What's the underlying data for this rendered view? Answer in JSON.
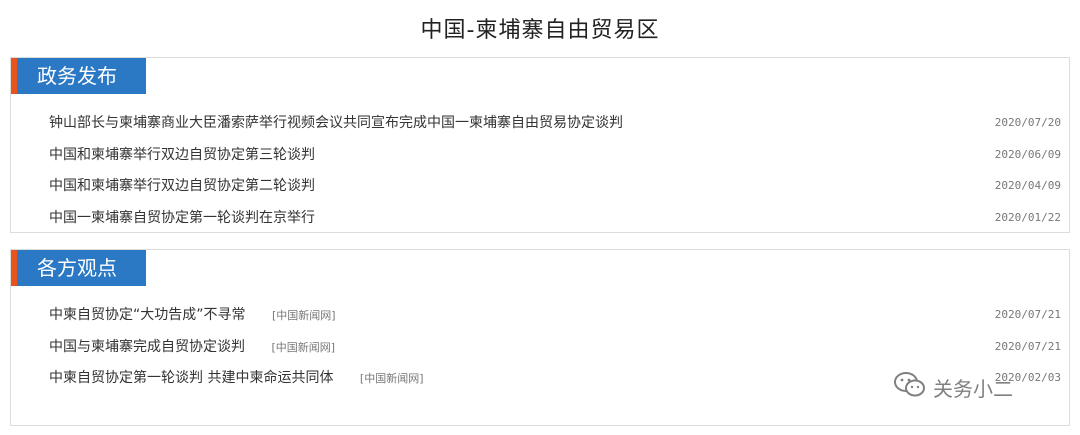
{
  "page": {
    "title": "中国-柬埔寨自由贸易区"
  },
  "sections": [
    {
      "title": "政务发布",
      "items": [
        {
          "title": "钟山部长与柬埔寨商业大臣潘索萨举行视频会议共同宣布完成中国一柬埔寨自由贸易协定谈判",
          "source": "",
          "date": "2020/07/20"
        },
        {
          "title": "中国和柬埔寨举行双边自贸协定第三轮谈判",
          "source": "",
          "date": "2020/06/09"
        },
        {
          "title": "中国和柬埔寨举行双边自贸协定第二轮谈判",
          "source": "",
          "date": "2020/04/09"
        },
        {
          "title": "中国一柬埔寨自贸协定第一轮谈判在京举行",
          "source": "",
          "date": "2020/01/22"
        }
      ]
    },
    {
      "title": "各方观点",
      "items": [
        {
          "title": "中柬自贸协定“大功告成”不寻常",
          "source": "[中国新闻网]",
          "date": "2020/07/21"
        },
        {
          "title": "中国与柬埔寨完成自贸协定谈判",
          "source": "[中国新闻网]",
          "date": "2020/07/21"
        },
        {
          "title": "中柬自贸协定第一轮谈判 共建中柬命运共同体",
          "source": "[中国新闻网]",
          "date": "2020/02/03"
        }
      ]
    }
  ],
  "watermark": {
    "text": "关务小二",
    "icon": "wechat-icon"
  }
}
